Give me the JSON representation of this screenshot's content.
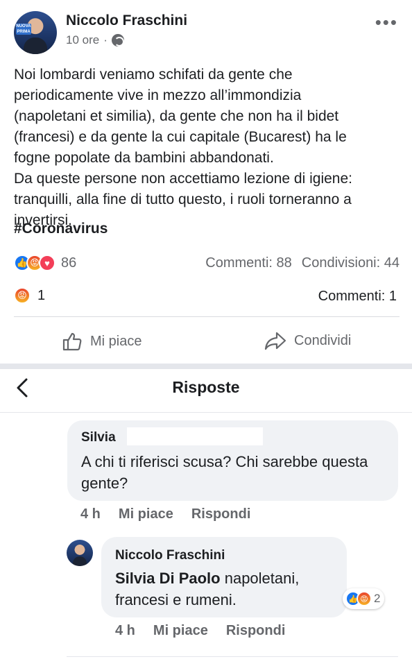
{
  "post": {
    "author": "Niccolo Fraschini",
    "time": "10 ore",
    "separator": "·",
    "avatar_badge": "NUOVA PRIMA",
    "text_lines": [
      "Noi lombardi veniamo schifati da gente che",
      "periodicamente vive in mezzo all’immondizia",
      "(napoletani et similia), da gente che non ha il bidet",
      "(francesi) e da gente la cui capitale (Bucarest) ha le",
      "fogne popolate da bambini abbandonati.",
      "Da queste persone non accettiamo lezione di igiene:",
      "tranquilli, alla fine di tutto questo, i ruoli torneranno a",
      "invertirsi."
    ],
    "hashtag": "#Coronavirus",
    "reaction_count": "86",
    "comments_label": "Commenti: 88",
    "shares_label": "Condivisioni: 44"
  },
  "sub_stats": {
    "angry_count": "1",
    "comments_label": "Commenti: 1"
  },
  "actions": {
    "like_label": "Mi piace",
    "share_label": "Condividi"
  },
  "replies": {
    "title": "Risposte"
  },
  "comment1": {
    "author": "Silvia",
    "text": "A chi ti riferisci scusa? Chi sarebbe questa gente?",
    "time": "4 h",
    "like": "Mi piace",
    "reply": "Rispondi"
  },
  "comment2": {
    "author": "Niccolo Fraschini",
    "mention": "Silvia Di Paolo",
    "text": " napoletani, francesi e rumeni.",
    "reaction_count": "2",
    "time": "4 h",
    "like": "Mi piace",
    "reply": "Rispondi"
  },
  "icons": {
    "like": "like-reaction-icon",
    "angry": "angry-reaction-icon",
    "love": "love-reaction-icon",
    "globe": "globe-icon",
    "more": "more-options-icon",
    "back": "back-arrow-icon",
    "thumb": "thumbs-up-icon",
    "share": "share-arrow-icon"
  },
  "colors": {
    "like_blue": "#1877f2",
    "angry_orange": "#e9442d",
    "love_red": "#f33e58",
    "secondary_text": "#65676b",
    "bubble_bg": "#f0f2f5"
  }
}
